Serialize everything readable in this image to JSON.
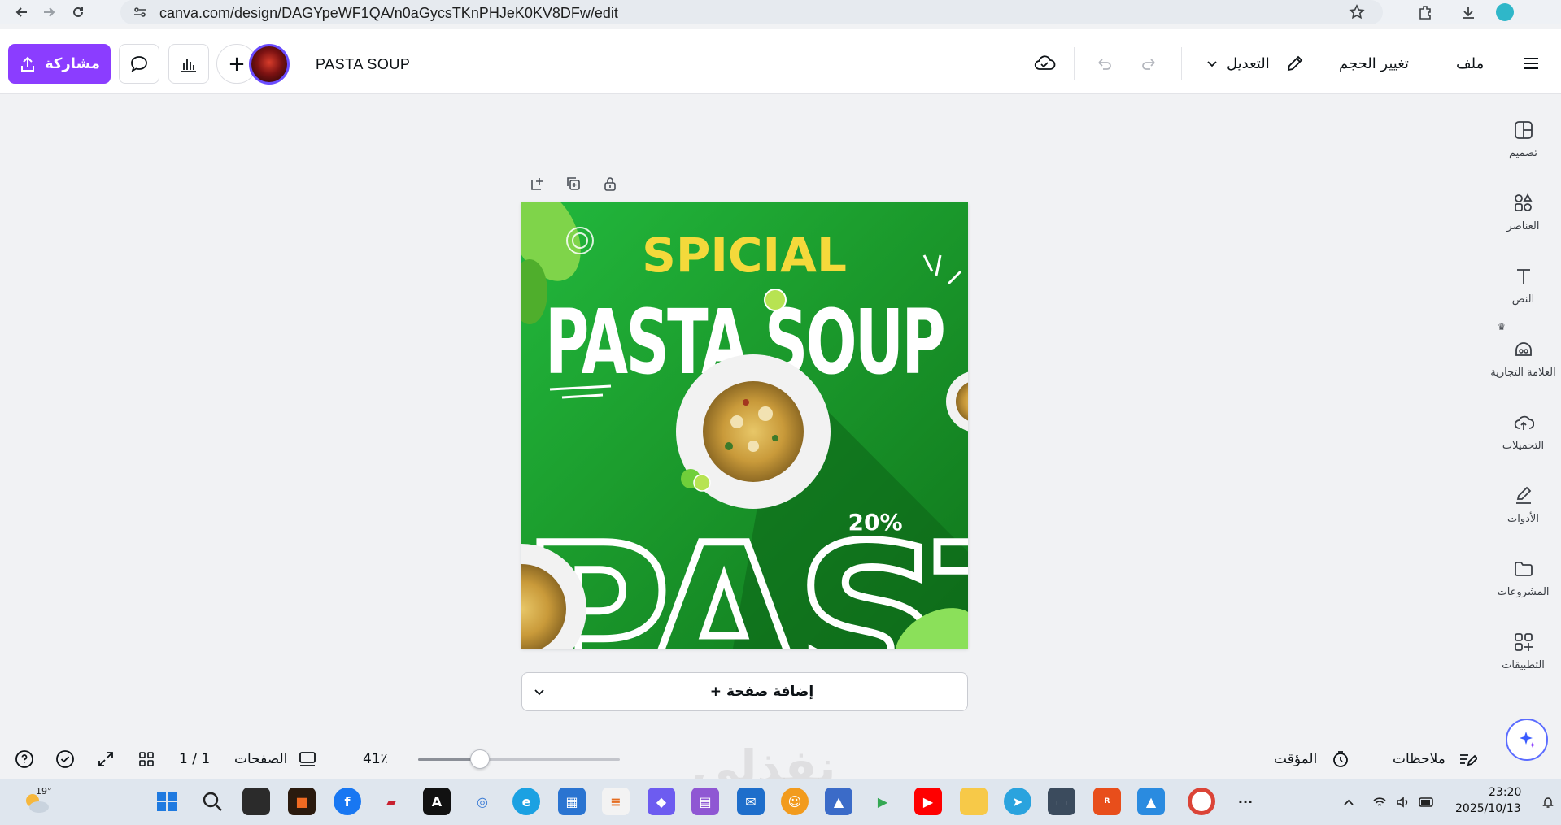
{
  "browser": {
    "url": "canva.com/design/DAGYpeWF1QA/n0aGycsTKnPHJeK0KV8DFw/edit"
  },
  "header": {
    "menu_label": "ملف",
    "resize_label": "تغيير الحجم",
    "edit_label": "التعديل",
    "design_title": "PASTA SOUP",
    "share_label": "مشاركة"
  },
  "sidebar": {
    "items": [
      {
        "label": "تصميم",
        "icon": "layout-icon"
      },
      {
        "label": "العناصر",
        "icon": "shapes-icon"
      },
      {
        "label": "النص",
        "icon": "text-icon"
      },
      {
        "label": "العلامة التجارية",
        "icon": "brand-icon"
      },
      {
        "label": "التحميلات",
        "icon": "cloud-upload-icon"
      },
      {
        "label": "الأدوات",
        "icon": "pen-icon"
      },
      {
        "label": "المشروعات",
        "icon": "folder-icon"
      },
      {
        "label": "التطبيقات",
        "icon": "apps-icon"
      }
    ]
  },
  "design": {
    "headline_small": "SPICIAL",
    "headline_big": "PASTA SOUP",
    "background_word": "PASTA",
    "discount": "20%",
    "bg_color": "#1c9e2e",
    "accent": "#f4d93b"
  },
  "add_page": {
    "label": "+ إضافة صفحة"
  },
  "bottom": {
    "notes_label": "ملاحظات",
    "timer_label": "المؤقت",
    "zoom_level": "41٪",
    "zoom_fraction": 0.41,
    "pages_label": "الصفحات",
    "page_counter": "1 / 1"
  },
  "taskbar": {
    "temperature": "19°",
    "time": "23:20",
    "date": "2025/10/13"
  }
}
